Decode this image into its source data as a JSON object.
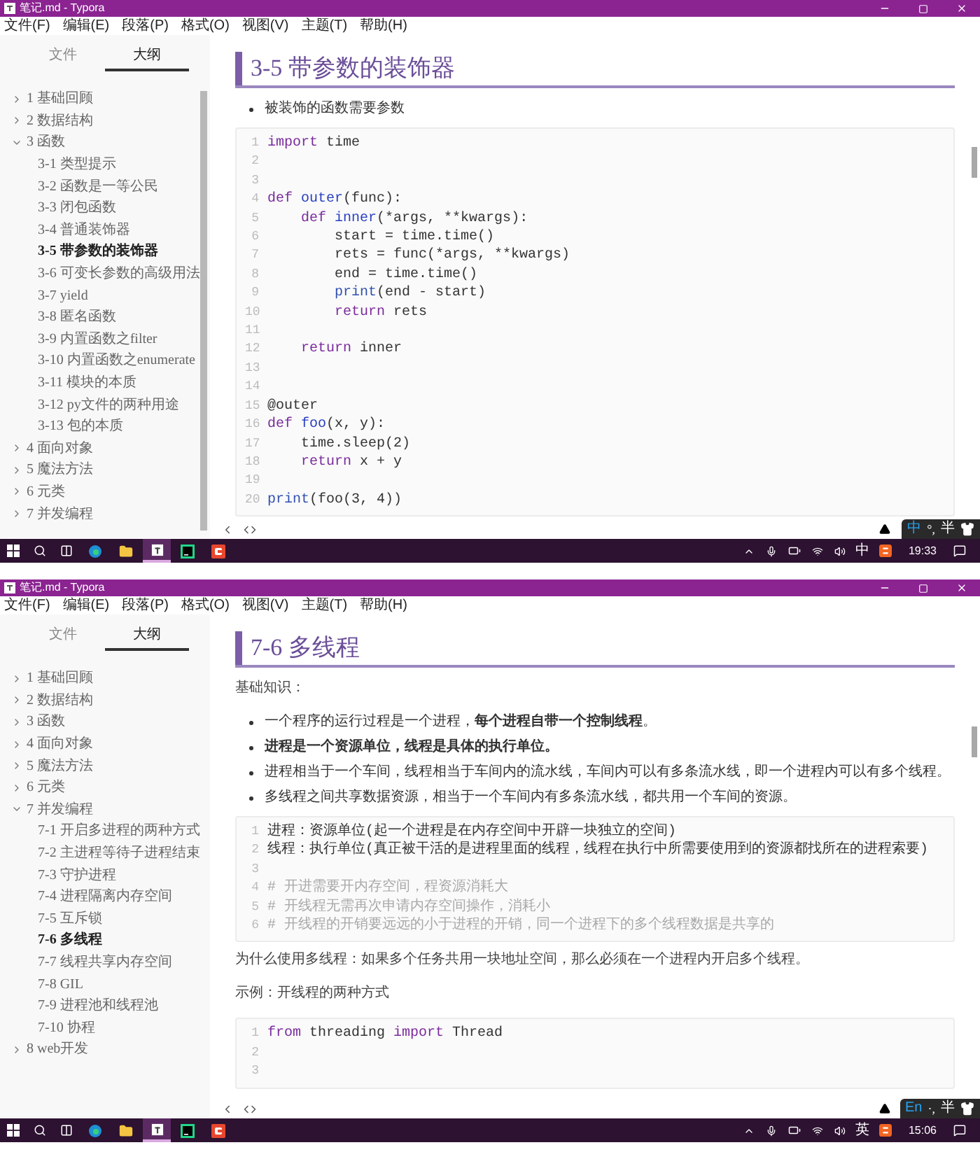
{
  "windows": [
    {
      "title": "笔记.md - Typora",
      "menu": [
        "文件(F)",
        "编辑(E)",
        "段落(P)",
        "格式(O)",
        "视图(V)",
        "主题(T)",
        "帮助(H)"
      ],
      "sidebar": {
        "scrollbar": true,
        "tabs": [
          {
            "label": "文件",
            "selected": false
          },
          {
            "label": "大纲",
            "selected": true
          }
        ],
        "outline": [
          {
            "label": "1 基础回顾",
            "expanded": false,
            "selected": false
          },
          {
            "label": "2 数据结构",
            "expanded": false,
            "selected": false
          },
          {
            "label": "3 函数",
            "expanded": true,
            "selected": false,
            "children": [
              {
                "label": "3-1 类型提示",
                "selected": false
              },
              {
                "label": "3-2 函数是一等公民",
                "selected": false
              },
              {
                "label": "3-3 闭包函数",
                "selected": false
              },
              {
                "label": "3-4 普通装饰器",
                "selected": false
              },
              {
                "label": "3-5 带参数的装饰器",
                "selected": true
              },
              {
                "label": "3-6 可变长参数的高级用法",
                "selected": false
              },
              {
                "label": "3-7 yield",
                "selected": false
              },
              {
                "label": "3-8 匿名函数",
                "selected": false
              },
              {
                "label": "3-9 内置函数之filter",
                "selected": false
              },
              {
                "label": "3-10 内置函数之enumerate",
                "selected": false
              },
              {
                "label": "3-11 模块的本质",
                "selected": false
              },
              {
                "label": "3-12 py文件的两种用途",
                "selected": false
              },
              {
                "label": "3-13 包的本质",
                "selected": false
              }
            ]
          },
          {
            "label": "4 面向对象",
            "expanded": false,
            "selected": false
          },
          {
            "label": "5 魔法方法",
            "expanded": false,
            "selected": false
          },
          {
            "label": "6 元类",
            "expanded": false,
            "selected": false
          },
          {
            "label": "7 并发编程",
            "expanded": false,
            "selected": false
          }
        ]
      },
      "blocks": [
        {
          "kind": "heading",
          "text": "3-5 带参数的装饰器"
        },
        {
          "kind": "bullets",
          "items": [
            "被装饰的函数需要参数"
          ]
        },
        {
          "kind": "code",
          "lines": [
            {
              "n": "1",
              "tokens": [
                {
                  "text": "import ",
                  "kind": "kw"
                },
                {
                  "text": "time",
                  "kind": "plain"
                }
              ]
            },
            {
              "n": "2"
            },
            {
              "n": "3"
            },
            {
              "n": "4",
              "tokens": [
                {
                  "text": "def ",
                  "kind": "kw"
                },
                {
                  "text": "outer",
                  "kind": "def"
                },
                {
                  "text": "(func):",
                  "kind": "plain"
                }
              ]
            },
            {
              "n": "5",
              "tokens": [
                {
                  "text": "    def ",
                  "kind": "kw"
                },
                {
                  "text": "inner",
                  "kind": "def"
                },
                {
                  "text": "(*args, **kwargs):",
                  "kind": "plain"
                }
              ]
            },
            {
              "n": "6",
              "tokens": [
                {
                  "text": "        start = time.time()",
                  "kind": "plain"
                }
              ]
            },
            {
              "n": "7",
              "tokens": [
                {
                  "text": "        rets = func(*args, **kwargs)",
                  "kind": "plain"
                }
              ]
            },
            {
              "n": "8",
              "tokens": [
                {
                  "text": "        end = time.time()",
                  "kind": "plain"
                }
              ]
            },
            {
              "n": "9",
              "tokens": [
                {
                  "text": "        print",
                  "kind": "builtin"
                },
                {
                  "text": "(end - start)",
                  "kind": "plain"
                }
              ]
            },
            {
              "n": "10",
              "tokens": [
                {
                  "text": "        return ",
                  "kind": "kw"
                },
                {
                  "text": "rets",
                  "kind": "plain"
                }
              ]
            },
            {
              "n": "11"
            },
            {
              "n": "12",
              "tokens": [
                {
                  "text": "    return ",
                  "kind": "kw"
                },
                {
                  "text": "inner",
                  "kind": "plain"
                }
              ]
            },
            {
              "n": "13"
            },
            {
              "n": "14"
            },
            {
              "n": "15",
              "tokens": [
                {
                  "text": "@outer",
                  "kind": "plain"
                }
              ]
            },
            {
              "n": "16",
              "tokens": [
                {
                  "text": "def ",
                  "kind": "kw"
                },
                {
                  "text": "foo",
                  "kind": "def"
                },
                {
                  "text": "(x, y):",
                  "kind": "plain"
                }
              ]
            },
            {
              "n": "17",
              "tokens": [
                {
                  "text": "    time.sleep(2)",
                  "kind": "plain"
                }
              ]
            },
            {
              "n": "18",
              "tokens": [
                {
                  "text": "    return ",
                  "kind": "kw"
                },
                {
                  "text": "x + y",
                  "kind": "plain"
                }
              ]
            },
            {
              "n": "19"
            },
            {
              "n": "20",
              "tokens": [
                {
                  "text": "print",
                  "kind": "builtin"
                },
                {
                  "text": "(foo(3, 4))",
                  "kind": "plain"
                }
              ]
            }
          ]
        }
      ],
      "ime": {
        "mode": "中",
        "punct": "°,",
        "width": "半"
      },
      "taskbar": {
        "apps": [
          {
            "kind": "browser",
            "selected": false
          },
          {
            "kind": "folder",
            "selected": false
          },
          {
            "kind": "typora",
            "selected": true
          },
          {
            "kind": "ide",
            "selected": false
          },
          {
            "kind": "recorder",
            "selected": false
          }
        ],
        "input_lang": "中",
        "time": "19:33"
      }
    },
    {
      "title": "笔记.md - Typora",
      "menu": [
        "文件(F)",
        "编辑(E)",
        "段落(P)",
        "格式(O)",
        "视图(V)",
        "主题(T)",
        "帮助(H)"
      ],
      "sidebar": {
        "scrollbar": false,
        "tabs": [
          {
            "label": "文件",
            "selected": false
          },
          {
            "label": "大纲",
            "selected": true
          }
        ],
        "outline": [
          {
            "label": "1 基础回顾",
            "expanded": false,
            "selected": false
          },
          {
            "label": "2 数据结构",
            "expanded": false,
            "selected": false
          },
          {
            "label": "3 函数",
            "expanded": false,
            "selected": false
          },
          {
            "label": "4 面向对象",
            "expanded": false,
            "selected": false
          },
          {
            "label": "5 魔法方法",
            "expanded": false,
            "selected": false
          },
          {
            "label": "6 元类",
            "expanded": false,
            "selected": false
          },
          {
            "label": "7 并发编程",
            "expanded": true,
            "selected": false,
            "children": [
              {
                "label": "7-1 开启多进程的两种方式",
                "selected": false
              },
              {
                "label": "7-2 主进程等待子进程结束",
                "selected": false
              },
              {
                "label": "7-3 守护进程",
                "selected": false
              },
              {
                "label": "7-4 进程隔离内存空间",
                "selected": false
              },
              {
                "label": "7-5 互斥锁",
                "selected": false
              },
              {
                "label": "7-6 多线程",
                "selected": true
              },
              {
                "label": "7-7 线程共享内存空间",
                "selected": false
              },
              {
                "label": "7-8 GIL",
                "selected": false
              },
              {
                "label": "7-9 进程池和线程池",
                "selected": false
              },
              {
                "label": "7-10 协程",
                "selected": false
              }
            ]
          },
          {
            "label": "8 web开发",
            "expanded": false,
            "selected": false
          }
        ]
      },
      "blocks": [
        {
          "kind": "heading",
          "text": "7-6 多线程"
        },
        {
          "kind": "paragraph",
          "text": "基础知识："
        },
        {
          "kind": "bullets",
          "items": [
            "一个程序的运行过程是一个进程，**每个进程自带一个控制线程**。",
            "**进程是一个资源单位，线程是具体的执行单位。**",
            "进程相当于一个车间，线程相当于车间内的流水线，车间内可以有多条流水线，即一个进程内可以有多个线程。",
            "多线程之间共享数据资源，相当于一个车间内有多条流水线，都共用一个车间的资源。"
          ]
        },
        {
          "kind": "code",
          "lines": [
            {
              "n": "1",
              "tokens": [
                {
                  "text": "进程：资源单位(起一个进程是在内存空间中开辟一块独立的空间)",
                  "kind": "plain"
                }
              ]
            },
            {
              "n": "2",
              "tokens": [
                {
                  "text": "线程：执行单位(真正被干活的是进程里面的线程，线程在执行中所需要使用到的资源都找所在的进程索要)",
                  "kind": "plain"
                }
              ]
            },
            {
              "n": "3"
            },
            {
              "n": "4",
              "tokens": [
                {
                  "text": "# 开进需要开内存空间，程资源消耗大",
                  "kind": "comment"
                }
              ]
            },
            {
              "n": "5",
              "tokens": [
                {
                  "text": "# 开线程无需再次申请内存空间操作，消耗小",
                  "kind": "comment"
                }
              ]
            },
            {
              "n": "6",
              "tokens": [
                {
                  "text": "# 开线程的开销要远远的小于进程的开销，同一个进程下的多个线程数据是共享的",
                  "kind": "comment"
                }
              ]
            }
          ]
        },
        {
          "kind": "paragraph",
          "text": "为什么使用多线程：如果多个任务共用一块地址空间，那么必须在一个进程内开启多个线程。"
        },
        {
          "kind": "paragraph",
          "text": "示例：开线程的两种方式"
        },
        {
          "kind": "code",
          "lines": [
            {
              "n": "1",
              "tokens": [
                {
                  "text": "from ",
                  "kind": "kw"
                },
                {
                  "text": "threading ",
                  "kind": "plain"
                },
                {
                  "text": "import ",
                  "kind": "kw"
                },
                {
                  "text": "Thread",
                  "kind": "plain"
                }
              ]
            },
            {
              "n": "2"
            },
            {
              "n": "3"
            }
          ]
        }
      ],
      "ime": {
        "mode": "En",
        "punct": "·,",
        "width": "半"
      },
      "taskbar": {
        "apps": [
          {
            "kind": "browser",
            "selected": false
          },
          {
            "kind": "folder",
            "selected": false
          },
          {
            "kind": "typora",
            "selected": true
          },
          {
            "kind": "ide",
            "selected": false
          },
          {
            "kind": "recorder",
            "selected": false
          }
        ],
        "input_lang": "英",
        "time": "15:06"
      }
    }
  ]
}
